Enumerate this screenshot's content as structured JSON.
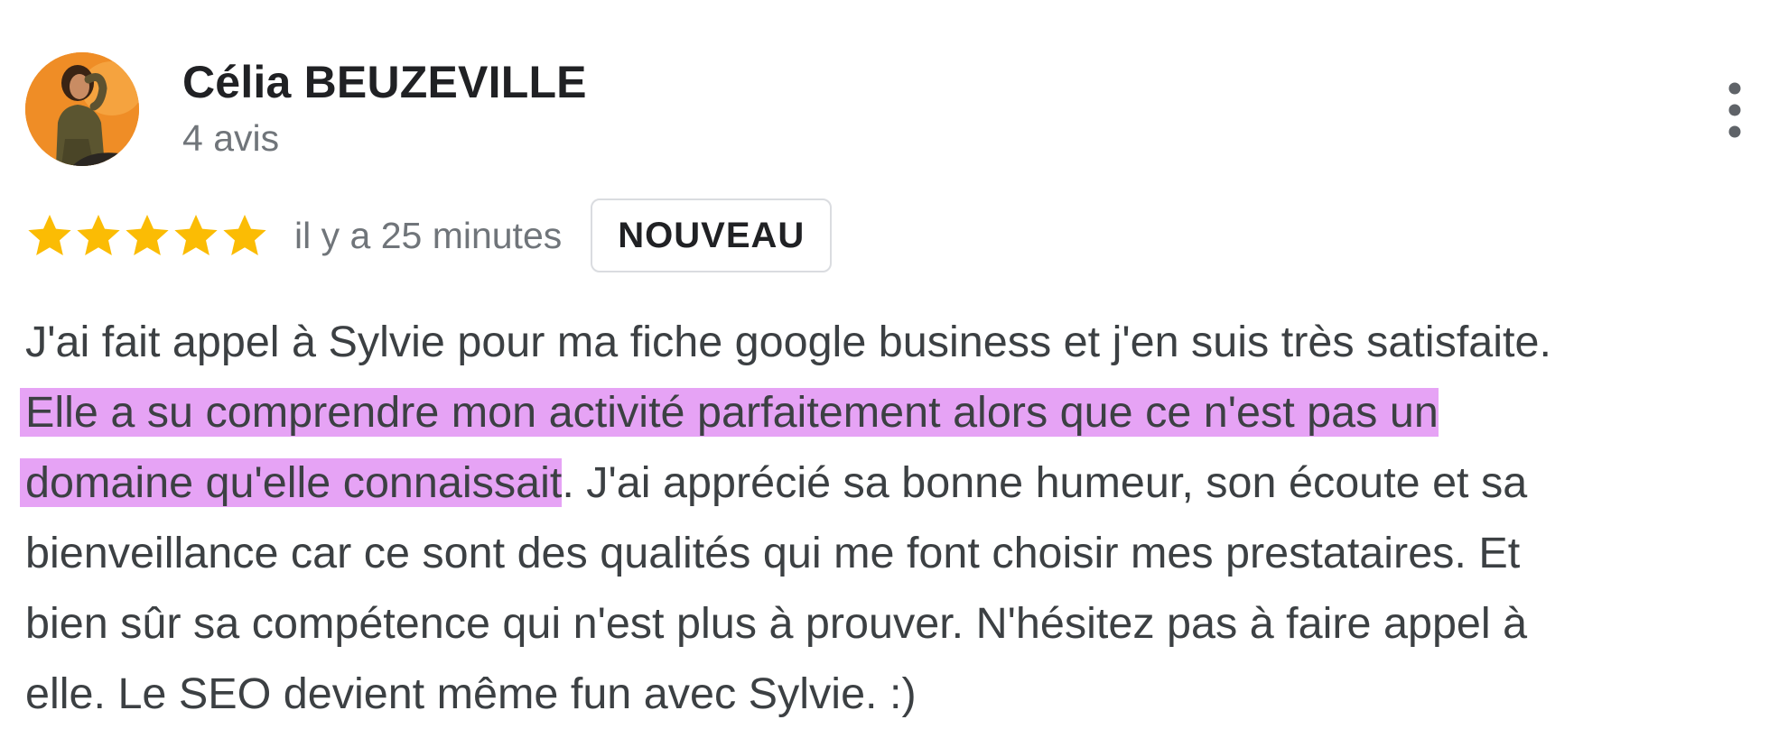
{
  "review": {
    "author": {
      "name": "Célia BEUZEVILLE",
      "meta": "4 avis"
    },
    "more_options_icon": "more-vertical-icon",
    "rating": {
      "stars": 5,
      "max": 5,
      "star_icon": "star-icon",
      "star_color": "#fbbc04"
    },
    "timestamp": "il y a 25 minutes",
    "badge": "NOUVEAU",
    "text_lines": [
      {
        "plain_before": "J'ai fait appel à Sylvie pour ma fiche google business et j'en suis très satisfaite.",
        "highlight": "",
        "plain_after": ""
      },
      {
        "plain_before": "",
        "highlight": "Elle a su comprendre mon activité parfaitement alors que ce n'est pas un",
        "plain_after": ""
      },
      {
        "plain_before": "",
        "highlight": "domaine qu'elle connaissait",
        "plain_after": ". J'ai apprécié sa bonne humeur, son écoute et sa"
      },
      {
        "plain_before": "bienveillance car ce sont des qualités qui me font choisir mes prestataires. Et",
        "highlight": "",
        "plain_after": ""
      },
      {
        "plain_before": "bien sûr sa compétence qui n'est plus à prouver. N'hésitez pas à faire appel à",
        "highlight": "",
        "plain_after": ""
      },
      {
        "plain_before": "elle. Le SEO devient même fun avec Sylvie. :)",
        "highlight": "",
        "plain_after": ""
      }
    ],
    "highlight_color": "#e6a3f5"
  }
}
